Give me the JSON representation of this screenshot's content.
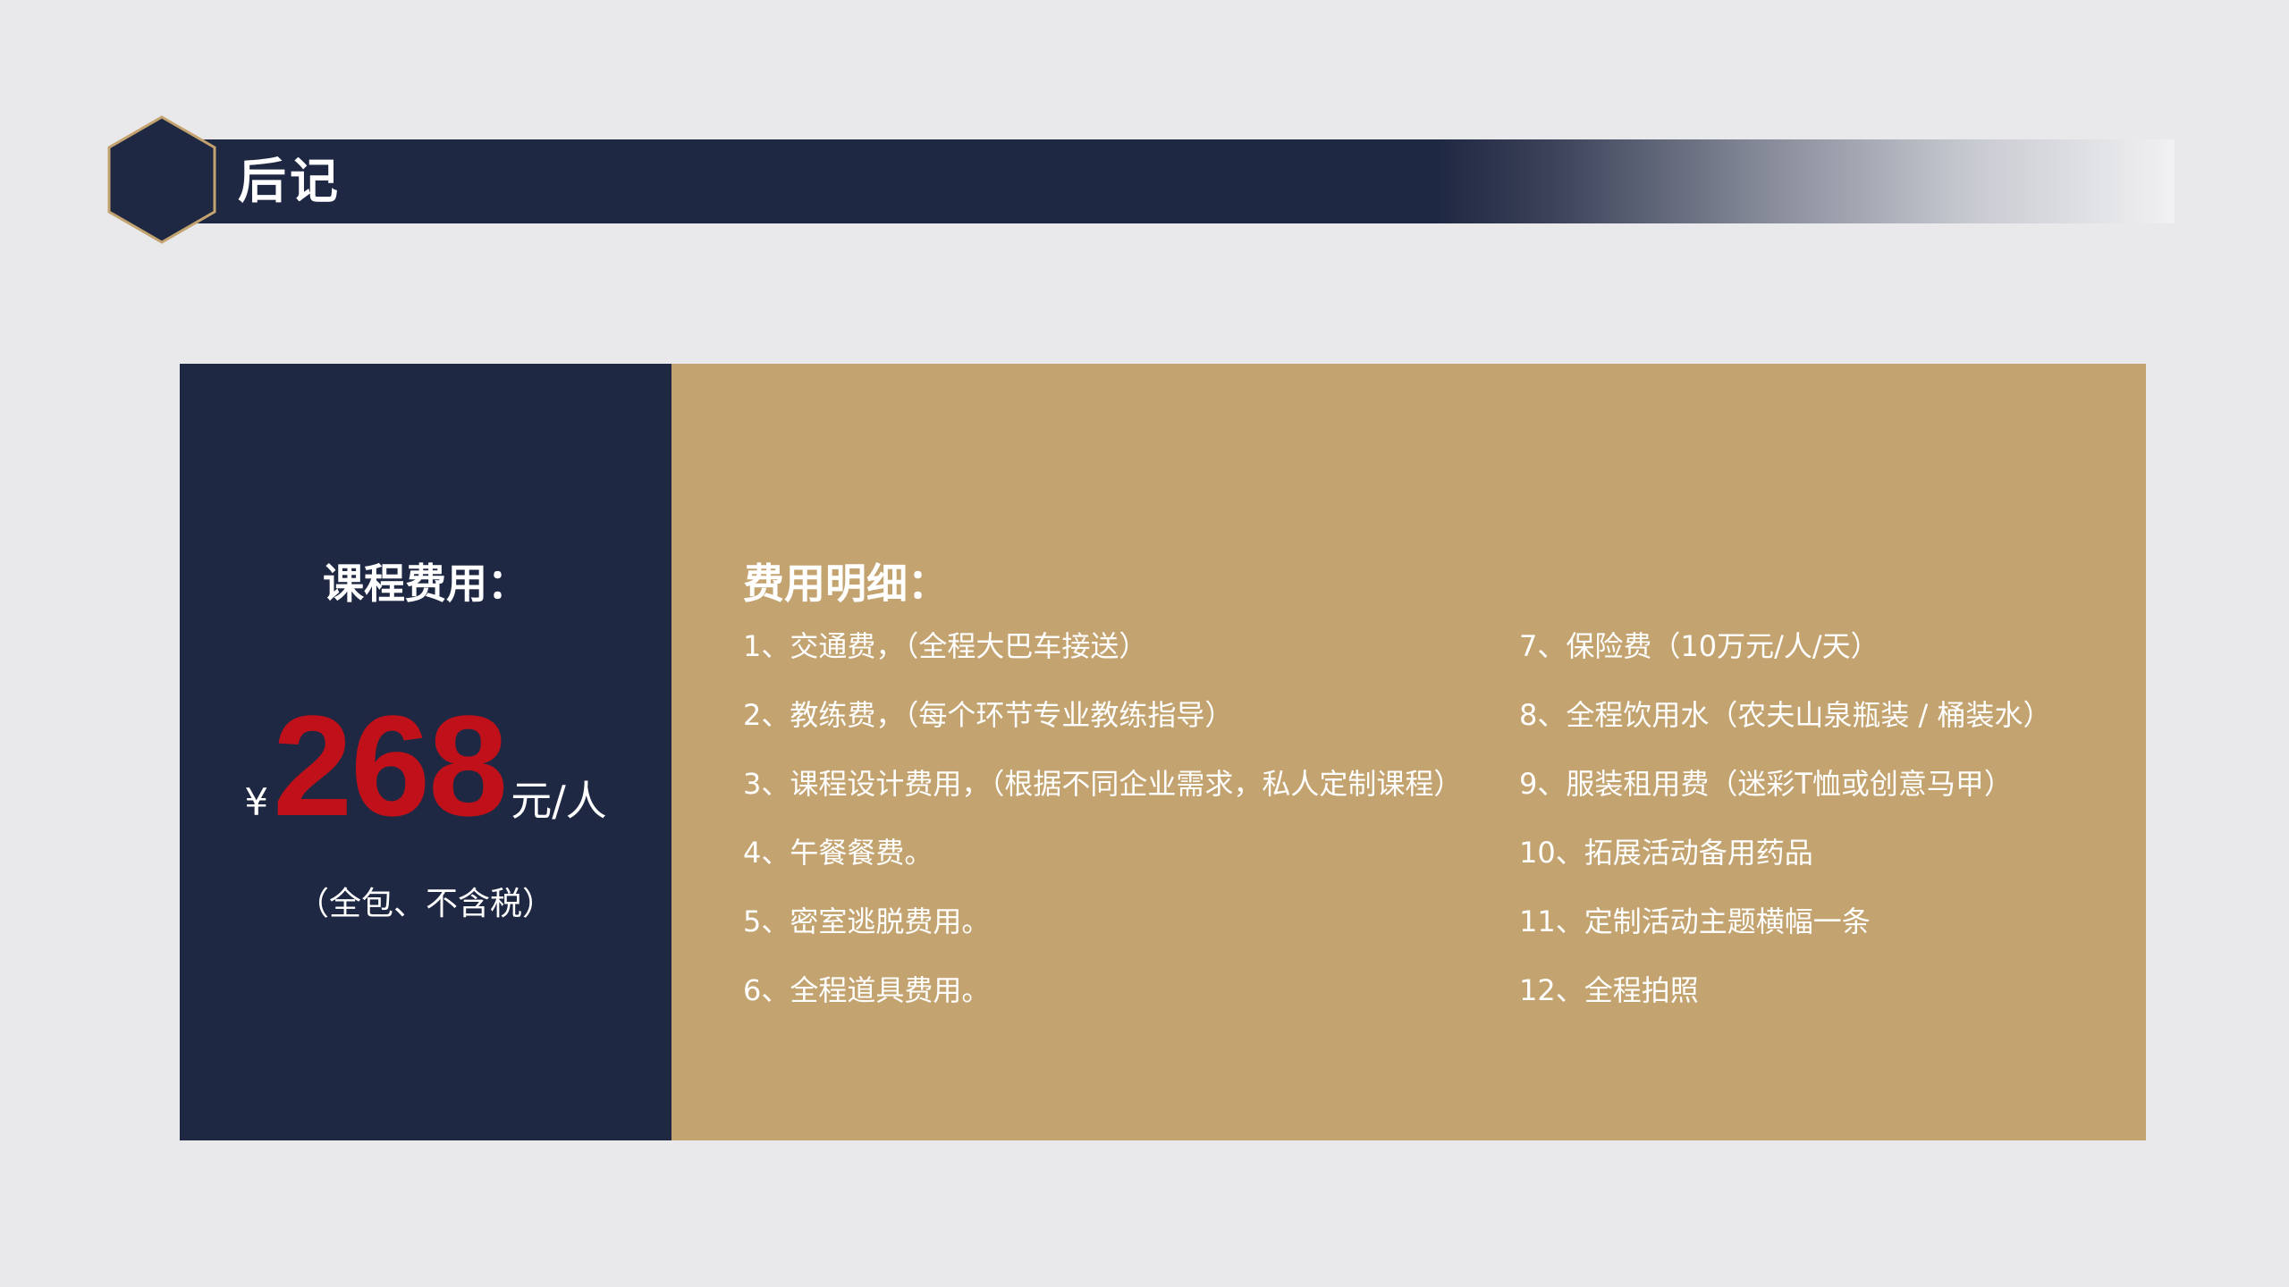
{
  "header": {
    "title": "后记"
  },
  "cost_panel": {
    "title": "课程费用：",
    "currency": "¥",
    "price": "268",
    "unit": "元/人",
    "note": "（全包、不含税）"
  },
  "detail_panel": {
    "title": "费用明细：",
    "left_items": [
      "1、交通费，（全程大巴车接送）",
      "2、教练费，（每个环节专业教练指导）",
      "3、课程设计费用，（根据不同企业需求，私人定制课程）",
      "4、午餐餐费。",
      "5、密室逃脱费用。",
      "6、全程道具费用。"
    ],
    "right_items": [
      "7、保险费（10万元/人/天）",
      "8、全程饮用水（农夫山泉瓶装 / 桶装水）",
      "9、服装租用费（迷彩T恤或创意马甲）",
      "10、拓展活动备用药品",
      "11、定制活动主题横幅一条",
      "12、全程拍照"
    ]
  },
  "colors": {
    "navy": "#1f2842",
    "gold": "#c3a36f",
    "price_red": "#c0101a",
    "background": "#e9e9eb"
  }
}
